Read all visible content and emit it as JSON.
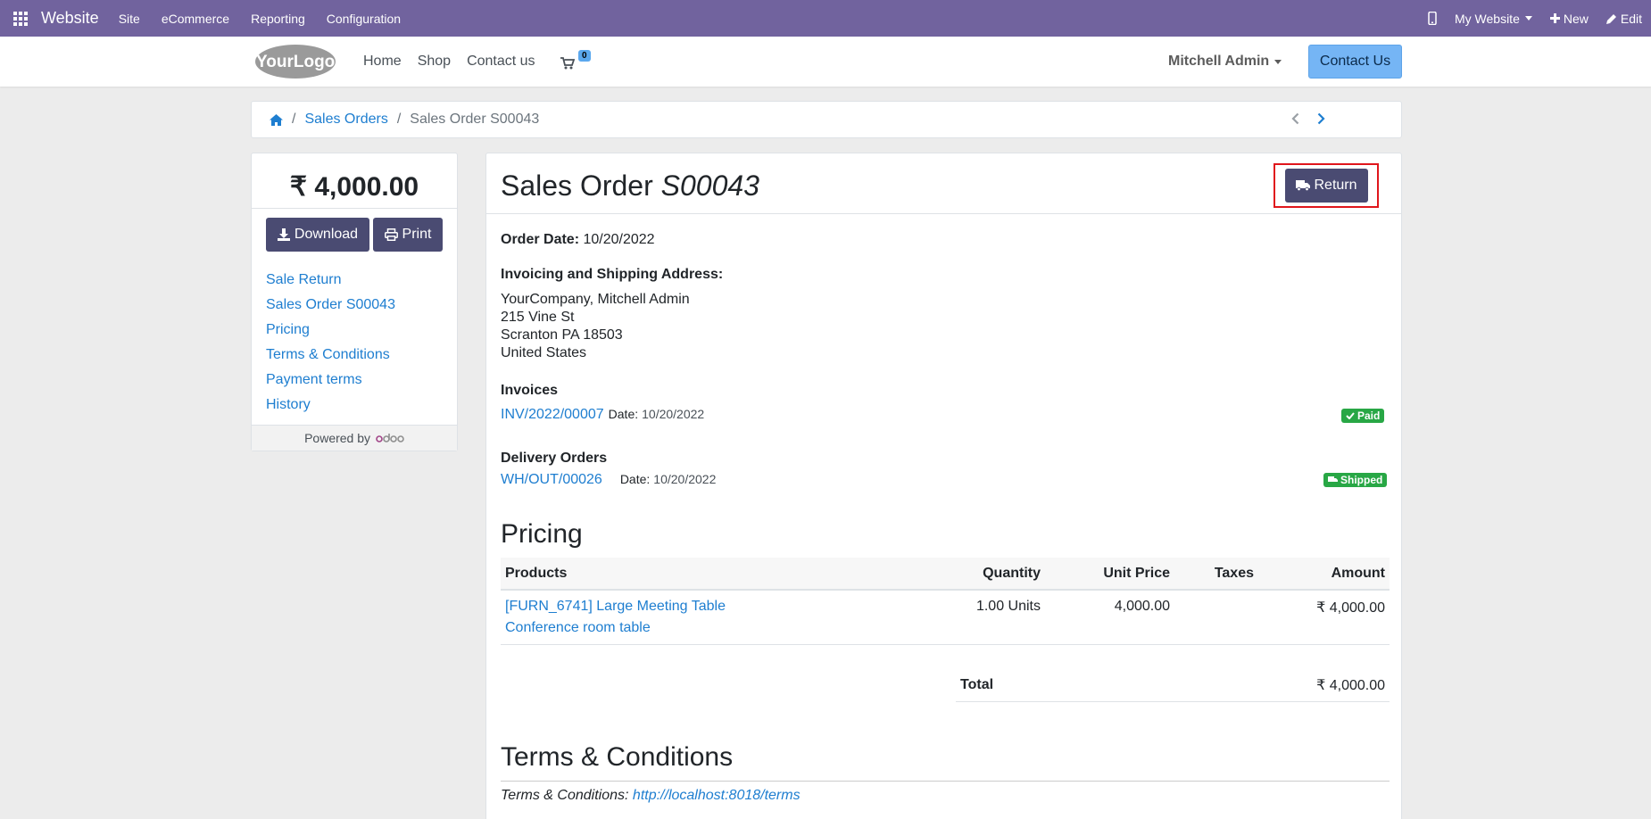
{
  "adminbar": {
    "brand": "Website",
    "menu": [
      "Site",
      "eCommerce",
      "Reporting",
      "Configuration"
    ],
    "website": "My Website",
    "new": "New",
    "edit": "Edit"
  },
  "header": {
    "logo_text": "YourLogo",
    "nav": [
      "Home",
      "Shop",
      "Contact us"
    ],
    "cart_count": "0",
    "user": "Mitchell Admin",
    "contact_btn": "Contact Us"
  },
  "breadcrumb": {
    "items": [
      "Sales Orders"
    ],
    "current": "Sales Order S00043"
  },
  "sidebar": {
    "amount": "₹ 4,000.00",
    "download": "Download",
    "print": "Print",
    "links": [
      "Sale Return",
      "Sales Order S00043",
      "Pricing",
      "Terms & Conditions",
      "Payment terms",
      "History"
    ],
    "powered_by": "Powered by",
    "odoo": "odoo"
  },
  "order": {
    "title_prefix": "Sales Order",
    "title_number": "S00043",
    "return_btn": "Return",
    "order_date_label": "Order Date:",
    "order_date": "10/20/2022",
    "address_label": "Invoicing and Shipping Address:",
    "address_lines": [
      "YourCompany, Mitchell Admin",
      "215 Vine St",
      "Scranton PA 18503",
      "United States"
    ],
    "invoices_label": "Invoices",
    "invoice_ref": "INV/2022/00007",
    "invoice_date_label": "Date:",
    "invoice_date": "10/20/2022",
    "invoice_status": "Paid",
    "delivery_label": "Delivery Orders",
    "delivery_ref": "WH/OUT/00026",
    "delivery_date_label": "Date:",
    "delivery_date": "10/20/2022",
    "delivery_status": "Shipped"
  },
  "pricing": {
    "heading": "Pricing",
    "columns": [
      "Products",
      "Quantity",
      "Unit Price",
      "Taxes",
      "Amount"
    ],
    "rows": [
      {
        "product_line1": "[FURN_6741] Large Meeting Table",
        "product_line2": "Conference room table",
        "quantity": "1.00 Units",
        "unit_price": "4,000.00",
        "taxes": "",
        "amount": "₹ 4,000.00"
      }
    ],
    "total_label": "Total",
    "total_value": "₹ 4,000.00"
  },
  "terms": {
    "heading": "Terms & Conditions",
    "label": "Terms & Conditions:",
    "link": "http://localhost:8018/terms"
  },
  "colors": {
    "adminbar": "#71639e",
    "primary_dark": "#4a4b72",
    "link": "#1e7ed0",
    "success": "#28a745",
    "highlight": "#e0161c"
  }
}
